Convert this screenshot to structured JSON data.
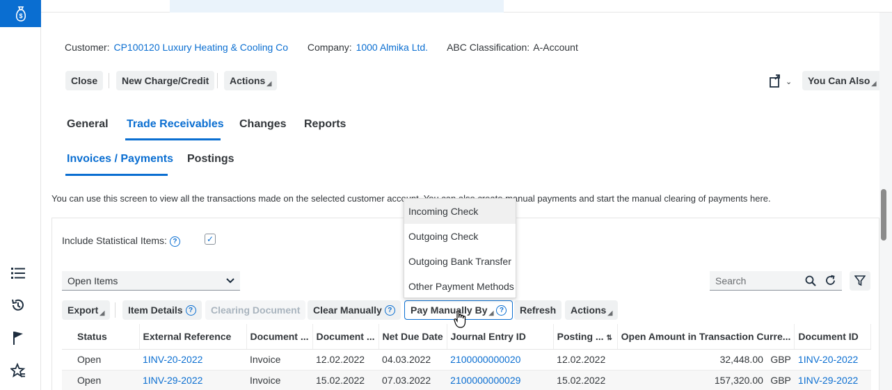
{
  "header": {
    "customer_label": "Customer:",
    "customer_value": "CP100120 Luxury Heating & Cooling Co",
    "company_label": "Company:",
    "company_value": "1000 Almika Ltd.",
    "abc_label": "ABC Classification:",
    "abc_value": "A-Account"
  },
  "toolbar": {
    "close": "Close",
    "new_charge": "New Charge/Credit",
    "actions": "Actions",
    "you_can_also": "You Can Also"
  },
  "tabs": [
    "General",
    "Trade Receivables",
    "Changes",
    "Reports"
  ],
  "subtabs": [
    "Invoices / Payments",
    "Postings"
  ],
  "hint_text": "You can use this screen to view all the transactions made on the selected customer account. You can also create manual payments and start the manual clearing of payments here.",
  "include_statistical_label": "Include Statistical Items:",
  "query_select": "Open Items",
  "search_placeholder": "Search",
  "table_toolbar": {
    "export": "Export",
    "item_details": "Item Details",
    "clearing_document": "Clearing Document",
    "clear_manually": "Clear Manually",
    "pay_manually_by": "Pay Manually By",
    "refresh": "Refresh",
    "actions": "Actions"
  },
  "dropdown_menu": [
    "Incoming Check",
    "Outgoing Check",
    "Outgoing Bank Transfer",
    "Other Payment Methods"
  ],
  "table": {
    "columns": [
      "Status",
      "External Reference",
      "Document ...",
      "Document ...",
      "Net Due Date",
      "Journal Entry ID",
      "Posting ...",
      "Open Amount in Transaction Curre...",
      "Document ID"
    ],
    "rows": [
      {
        "status": "Open",
        "ext_ref": "1INV-20-2022",
        "doc_type": "Invoice",
        "doc_date": "12.02.2022",
        "net_due": "04.03.2022",
        "journal": "2100000000020",
        "posting": "12.02.2022",
        "amount": "32,448.00",
        "currency": "GBP",
        "doc_id": "1INV-20-2022"
      },
      {
        "status": "Open",
        "ext_ref": "1INV-29-2022",
        "doc_type": "Invoice",
        "doc_date": "15.02.2022",
        "net_due": "07.03.2022",
        "journal": "2100000000029",
        "posting": "15.02.2022",
        "amount": "157,320.00",
        "currency": "GBP",
        "doc_id": "1INV-29-2022"
      }
    ]
  },
  "colors": {
    "accent": "#0a6ed1",
    "shell": "#0a6ed1",
    "text": "#32363a"
  }
}
